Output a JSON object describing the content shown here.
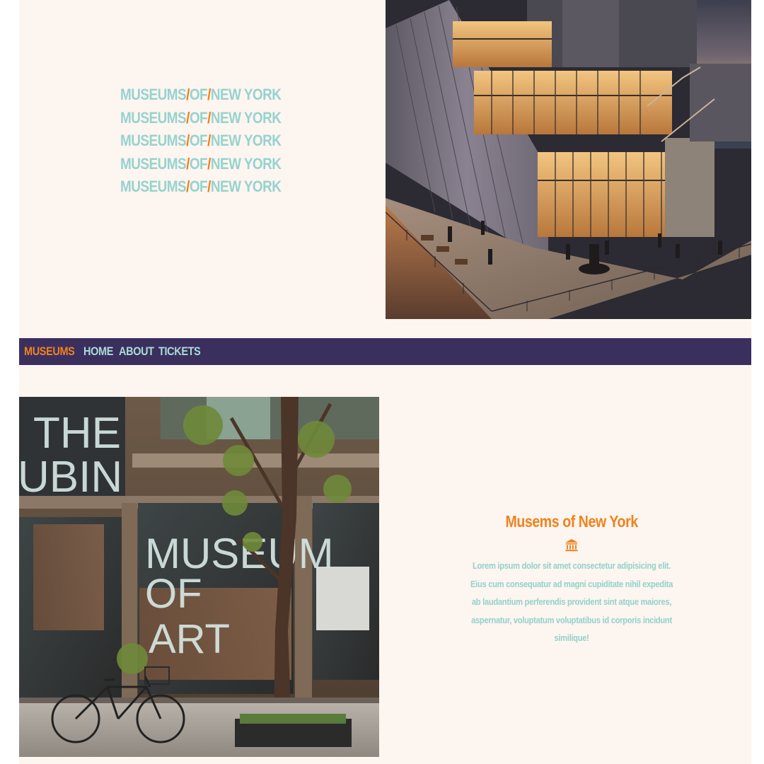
{
  "hero": {
    "lines": [
      {
        "a": "MUSEUMS",
        "s1": "/",
        "b": "OF",
        "s2": "/",
        "c": "NEW YORK"
      },
      {
        "a": "MUSEUMS",
        "s1": "/",
        "b": "OF",
        "s2": "/",
        "c": "NEW YORK"
      },
      {
        "a": "MUSEUMS",
        "s1": "/",
        "b": "OF",
        "s2": "/",
        "c": "NEW YORK"
      },
      {
        "a": "MUSEUMS",
        "s1": "/",
        "b": "OF",
        "s2": "/",
        "c": "NEW YORK"
      },
      {
        "a": "MUSEUMS",
        "s1": "/",
        "b": "OF",
        "s2": "/",
        "c": "NEW YORK"
      }
    ]
  },
  "navbar": {
    "brand": "MUSEUMS",
    "links": [
      "HOME",
      "ABOUT",
      "TICKETS"
    ]
  },
  "feature": {
    "title": "Musems of New York",
    "icon": "museum-icon",
    "body": "Lorem ipsum dolor sit amet consectetur adipisicing elit. Eius cum consequatur ad magni cupiditate nihil expedita ab laudantium perferendis provident sint atque maiores, aspernatur, voluptatum voluptatibus id corporis incidunt similique!"
  },
  "images": {
    "hero_image": {
      "signage": ""
    },
    "feature_image": {
      "signage": [
        "THE",
        "UBIN",
        "MUSEUM",
        "OF",
        "ART"
      ]
    }
  },
  "colors": {
    "background": "#fdf5ef",
    "accent_teal": "#96d3cf",
    "accent_orange": "#f0821e",
    "navbar": "#3b2f5e"
  }
}
